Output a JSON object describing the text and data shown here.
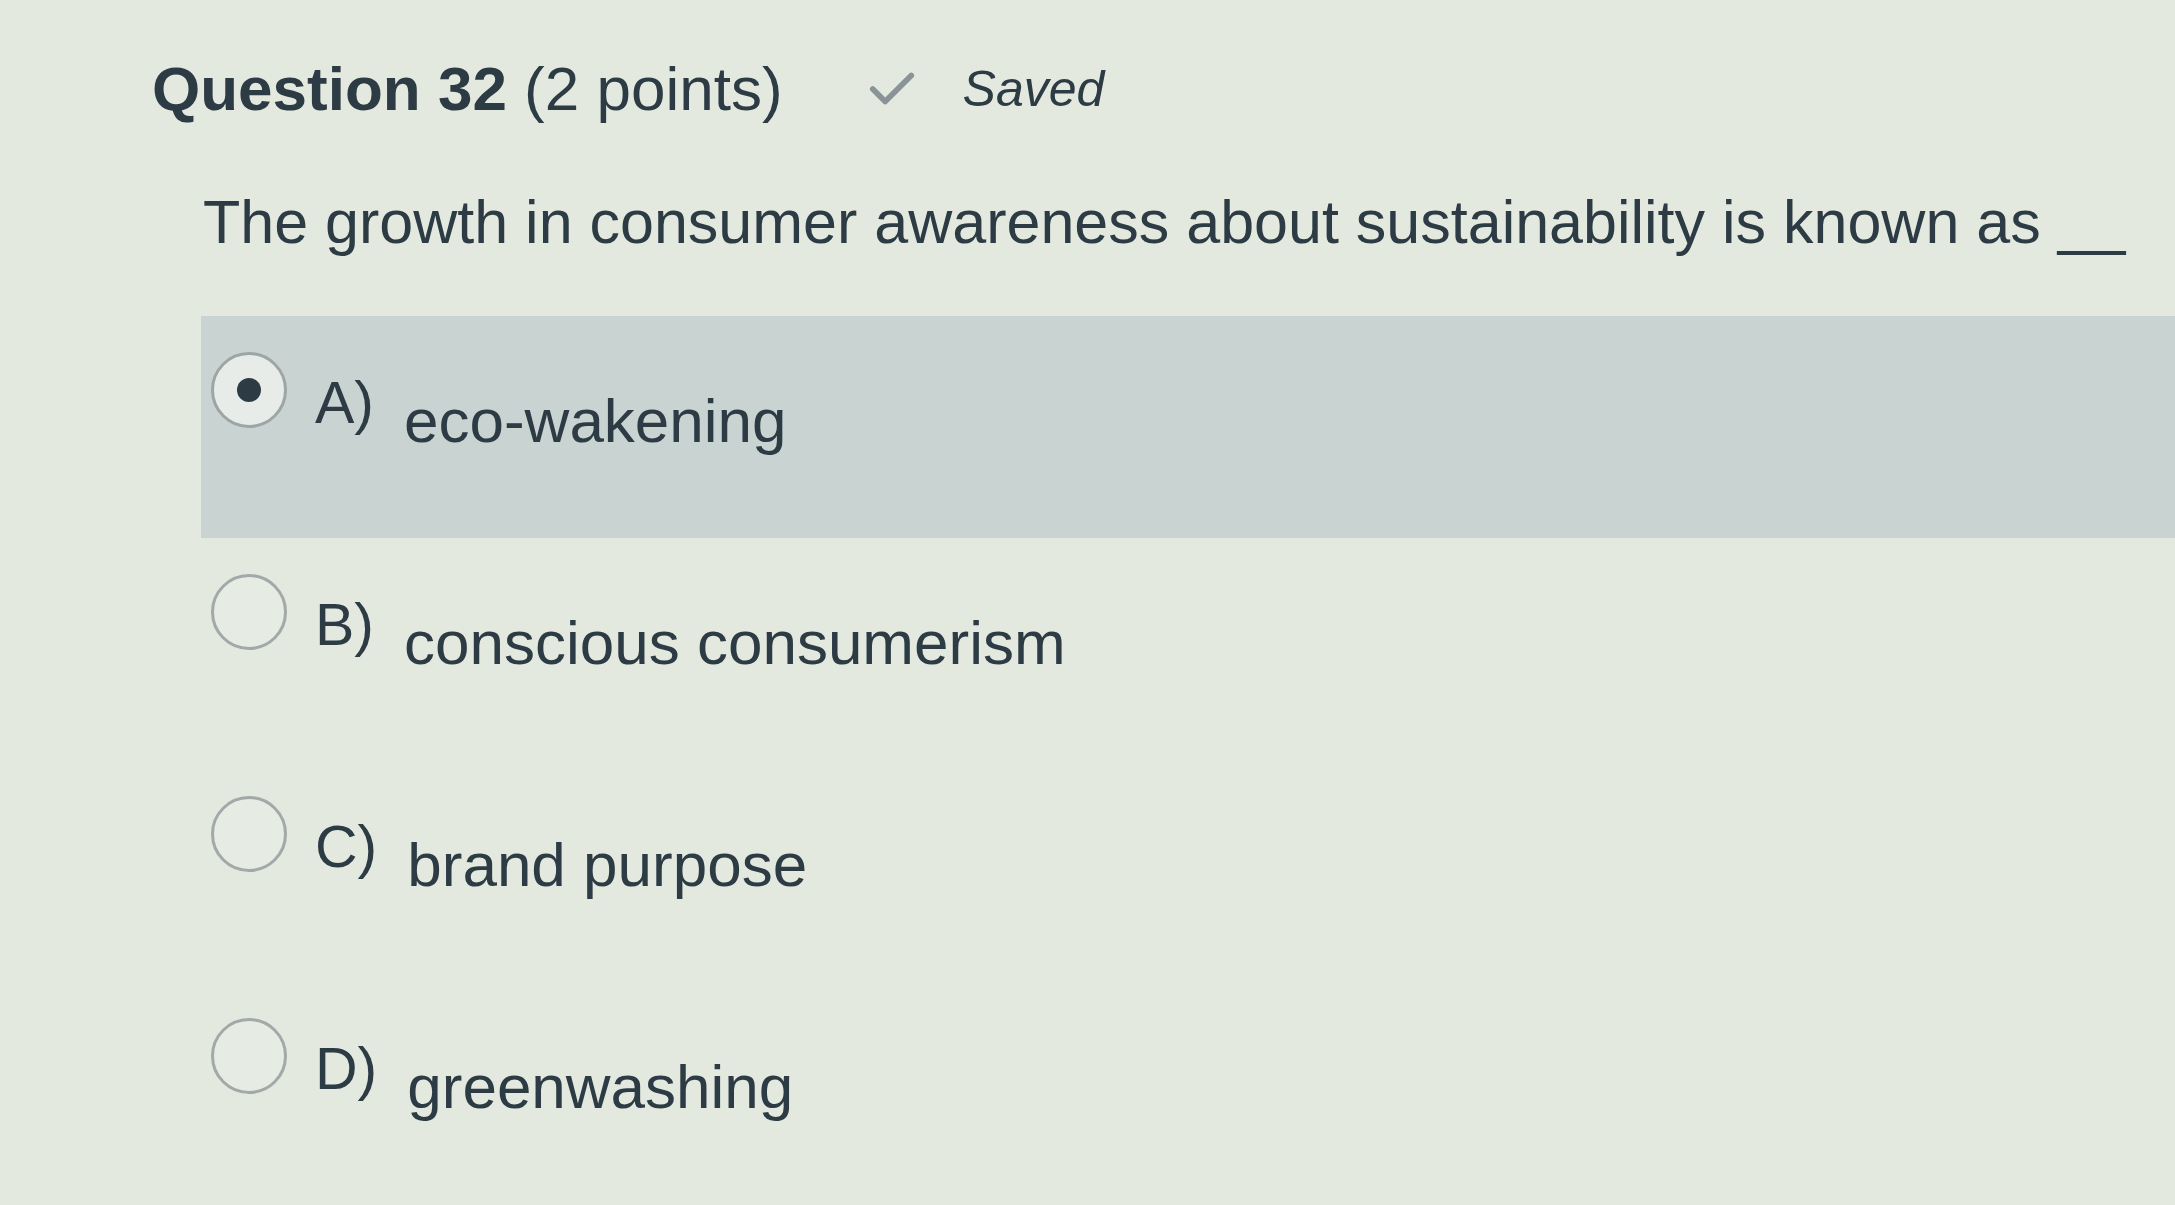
{
  "question": {
    "title": "**Question 32** (2 points)",
    "status": "Saved",
    "text": "The growth in consumer awareness about sustainability is known as __"
  },
  "options": [
    {
      "letter": "A)",
      "text": "eco-wakening",
      "selected": true
    },
    {
      "letter": "B)",
      "text": "conscious consumerism",
      "selected": false
    },
    {
      "letter": "C)",
      "text": "brand purpose",
      "selected": false
    },
    {
      "letter": "D)",
      "text": "greenwashing",
      "selected": false
    }
  ]
}
